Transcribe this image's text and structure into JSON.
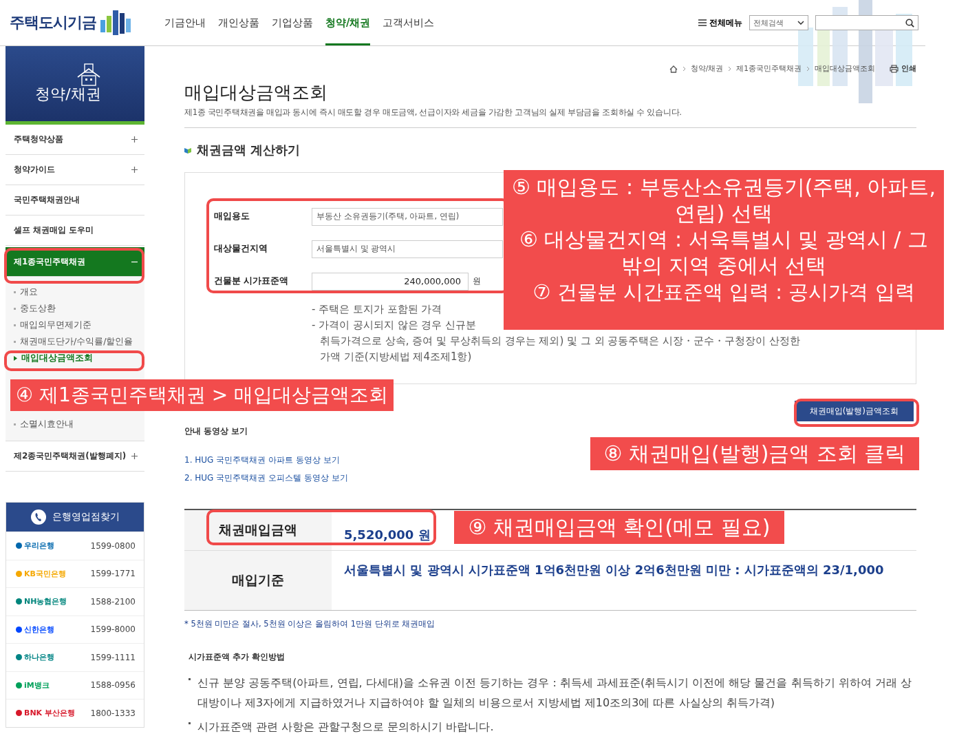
{
  "header": {
    "logo": "주택도시기금",
    "nav": [
      {
        "label": "기금안내",
        "selected": false
      },
      {
        "label": "개인상품",
        "selected": false
      },
      {
        "label": "기업상품",
        "selected": false
      },
      {
        "label": "청약/채권",
        "selected": true
      },
      {
        "label": "고객서비스",
        "selected": false
      }
    ],
    "all_menu": "전체메뉴",
    "search_scope": "전체검색"
  },
  "sidebar": {
    "title": "청약/채권",
    "items": [
      {
        "label": "주택청약상품",
        "expandable": true,
        "expanded": false
      },
      {
        "label": "청약가이드",
        "expandable": true,
        "expanded": false
      },
      {
        "label": "국민주택채권안내",
        "expandable": false,
        "expanded": false
      },
      {
        "label": "셀프 채권매입 도우미",
        "expandable": false,
        "expanded": false
      },
      {
        "label": "제1종국민주택채권",
        "expandable": true,
        "expanded": true,
        "children": [
          {
            "label": "개요",
            "selected": false
          },
          {
            "label": "중도상환",
            "selected": false
          },
          {
            "label": "매입의무면제기준",
            "selected": false
          },
          {
            "label": "채권매도단가/수익률/할인율",
            "selected": false
          },
          {
            "label": "매입대상금액조회",
            "selected": true
          },
          {
            "label": "소멸시효안내",
            "selected": false
          }
        ]
      },
      {
        "label": "제2종국민주택채권(발행폐지)",
        "expandable": true,
        "expanded": false
      }
    ]
  },
  "banks": {
    "title": "은행영업점찾기",
    "rows": [
      {
        "name": "우리은행",
        "phone": "1599-0800",
        "color": "#0067ac"
      },
      {
        "name": "KB국민은행",
        "phone": "1599-1771",
        "color": "#f5a800"
      },
      {
        "name": "NH농협은행",
        "phone": "1588-2100",
        "color": "#00857c"
      },
      {
        "name": "신한은행",
        "phone": "1599-8000",
        "color": "#0046ff"
      },
      {
        "name": "하나은행",
        "phone": "1599-1111",
        "color": "#008485"
      },
      {
        "name": "iM뱅크",
        "phone": "1588-0956",
        "color": "#00a05a"
      },
      {
        "name": "BNK 부산은행",
        "phone": "1800-1333",
        "color": "#d7182a"
      }
    ]
  },
  "breadcrumb": [
    "청약/채권",
    "제1종국민주택채권",
    "매입대상금액조회"
  ],
  "print": "인쇄",
  "page_title": "매입대상금액조회",
  "page_description": "제1종 국민주택채권을 매입과 동시에 즉시 매도할 경우 매도금액, 선급이자와 세금을 가감한 고객님의 실제 부담금을 조회하실 수 있습니다.",
  "calculator": {
    "title": "채권금액 계산하기",
    "fields": [
      {
        "kind": "select",
        "label": "매입용도",
        "value": "부동산 소유권등기(주택, 아파트, 연립)"
      },
      {
        "kind": "select",
        "label": "대상물건지역",
        "value": "서울특별시 및 광역시"
      },
      {
        "kind": "input",
        "label": "건물분 시가표준액",
        "value": "240,000,000",
        "unit": "원"
      }
    ],
    "notes": [
      "- 주택은 토지가 포함된 가격",
      "- 가격이 공시되지 않은 경우 신규분",
      "취득가격으로 상속, 증여 및 무상취득의 경우는 제외) 및 그 외 공동주택은 시장・군수・구청장이 산정한",
      "가액 기준(지방세법 제4조제1항)"
    ]
  },
  "submit_button": "채권매입(발행)금액조회",
  "video_guide": {
    "title": "안내 동영상 보기",
    "links": [
      "1. HUG 국민주택채권 아파트 동영상 보기",
      "2. HUG 국민주택채권 오피스텔 동영상 보기"
    ]
  },
  "result": {
    "rows": [
      {
        "label": "채권매입금액",
        "value": "5,520,000 원"
      },
      {
        "label": "매입기준",
        "value": "서울특별시 및 광역시 시가표준액 1억6천만원 이상 2억6천만원 미만 : 시가표준액의 23/1,000"
      }
    ]
  },
  "footnote": "* 5천원 미만은 절사, 5천원 이상은 올림하여 1만원 단위로 채권매입",
  "method": {
    "title": "시가표준액 추가 확인방법",
    "bullets": [
      "신규 분양 공동주택(아파트, 연립, 다세대)을 소유권 이전 등기하는 경우 : 취득세 과세표준(취득시기 이전에 해당 물건을 취득하기 위하여 거래 상대방이나 제3자에게 지급하였거나 지급하여야 할 일체의 비용으로서 지방세법 제10조의3에 따른 사실상의 취득가격)",
      "시가표준액 관련 사항은 관할구청으로 문의하시기 바랍니다."
    ]
  },
  "callouts": [
    {
      "kind": "sidebar",
      "texts": [
        "④ 제1종국민주택채권 > 매입대상금액조회"
      ]
    },
    {
      "kind": "form",
      "texts": [
        "⑤ 매입용도 : 부동산소유권등기(주택, 아파트, 연립) 선택",
        "⑥ 대상물건지역 : 서욱특별시 및 광역시 / 그 밖의 지역 중에서 선택",
        "⑦ 건물분 시간표준액 입력 : 공시가격 입력"
      ]
    },
    {
      "kind": "button",
      "texts": [
        "⑧ 채권매입(발행)금액 조회 클릭"
      ]
    },
    {
      "kind": "result",
      "texts": [
        "⑨ 채권매입금액 확인(메모 필요)"
      ]
    }
  ]
}
